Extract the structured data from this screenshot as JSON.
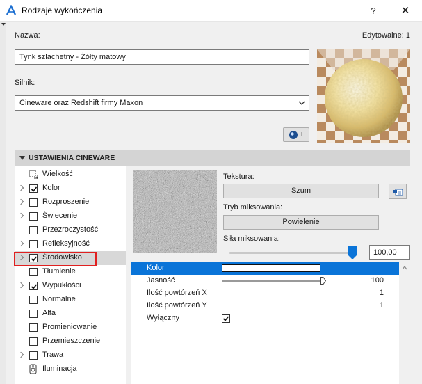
{
  "window": {
    "title": "Rodzaje wykończenia",
    "help": "?",
    "close": "✕"
  },
  "name_label": "Nazwa:",
  "editable_label": "Edytowalne: 1",
  "name_value": "Tynk szlachetny - Żółty matowy",
  "engine_label": "Silnik:",
  "engine_value": "Cineware oraz Redshift firmy Maxon",
  "render_button_label": "i",
  "section_title": "USTAWIENIA CINEWARE",
  "tree": [
    {
      "label": "Wielkość",
      "arrow": false,
      "kind": "icon-size",
      "checked": false
    },
    {
      "label": "Kolor",
      "arrow": true,
      "kind": "cb",
      "checked": true
    },
    {
      "label": "Rozproszenie",
      "arrow": true,
      "kind": "cb",
      "checked": false
    },
    {
      "label": "Świecenie",
      "arrow": true,
      "kind": "cb",
      "checked": false
    },
    {
      "label": "Przezroczystość",
      "arrow": false,
      "kind": "cb",
      "checked": false
    },
    {
      "label": "Refleksyjność",
      "arrow": true,
      "kind": "cb",
      "checked": false
    },
    {
      "label": "Środowisko",
      "arrow": true,
      "kind": "cb",
      "checked": true
    },
    {
      "label": "Tłumienie",
      "arrow": false,
      "kind": "cb",
      "checked": false
    },
    {
      "label": "Wypukłości",
      "arrow": true,
      "kind": "cb",
      "checked": true
    },
    {
      "label": "Normalne",
      "arrow": false,
      "kind": "cb",
      "checked": false
    },
    {
      "label": "Alfa",
      "arrow": false,
      "kind": "cb",
      "checked": false
    },
    {
      "label": "Promieniowanie",
      "arrow": false,
      "kind": "cb",
      "checked": false
    },
    {
      "label": "Przemieszczenie",
      "arrow": false,
      "kind": "cb",
      "checked": false
    },
    {
      "label": "Trawa",
      "arrow": true,
      "kind": "cb",
      "checked": false
    },
    {
      "label": "Iluminacja",
      "arrow": false,
      "kind": "icon-illum",
      "checked": false
    }
  ],
  "selected_tree_item": "Środowisko",
  "texture_label": "Tekstura:",
  "texture_value": "Szum",
  "blend_mode_label": "Tryb miksowania:",
  "blend_mode_value": "Powielenie",
  "blend_strength_label": "Siła miksowania:",
  "blend_strength_value": "100,00",
  "blend_strength_fraction": 1.0,
  "properties": [
    {
      "name": "Kolor",
      "value": "",
      "kind": "color",
      "color": "#ffffff"
    },
    {
      "name": "Jasność",
      "value": "100",
      "kind": "slider",
      "fraction": 1.0
    },
    {
      "name": "Ilość powtórzeń X",
      "value": "1",
      "kind": "text"
    },
    {
      "name": "Ilość powtórzeń Y",
      "value": "1",
      "kind": "text"
    },
    {
      "name": "Wyłączny",
      "value": "",
      "kind": "check",
      "checked": true
    }
  ],
  "colors": {
    "accent": "#0a74d8",
    "highlight_box": "#e02020"
  }
}
